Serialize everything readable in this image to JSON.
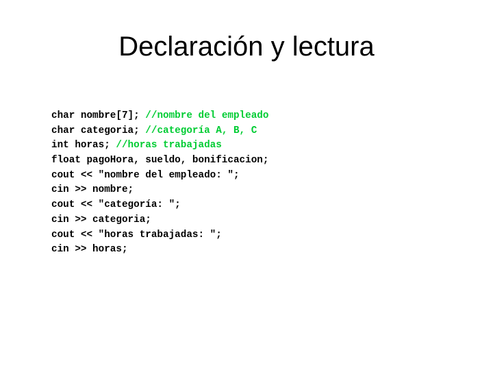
{
  "slide": {
    "title": "Declaración y lectura",
    "background_color": "#ffffff",
    "title_color": "#000000",
    "code_color": "#000000",
    "comment_color": "#00cc33",
    "code_lines": [
      {
        "code": "char nombre[7]; ",
        "comment": "//nombre del empleado"
      },
      {
        "code": "char categoria; ",
        "comment": "//categoría A, B, C"
      },
      {
        "code": "int horas; ",
        "comment": "//horas trabajadas"
      },
      {
        "code": "float pagoHora, sueldo, bonificacion;",
        "comment": ""
      },
      {
        "code": "cout << \"nombre del empleado: \";",
        "comment": ""
      },
      {
        "code": "cin >> nombre;",
        "comment": ""
      },
      {
        "code": "cout << \"categoría: \";",
        "comment": ""
      },
      {
        "code": "cin >> categoria;",
        "comment": ""
      },
      {
        "code": "cout << \"horas trabajadas: \";",
        "comment": ""
      },
      {
        "code": "cin >> horas;",
        "comment": ""
      }
    ]
  }
}
